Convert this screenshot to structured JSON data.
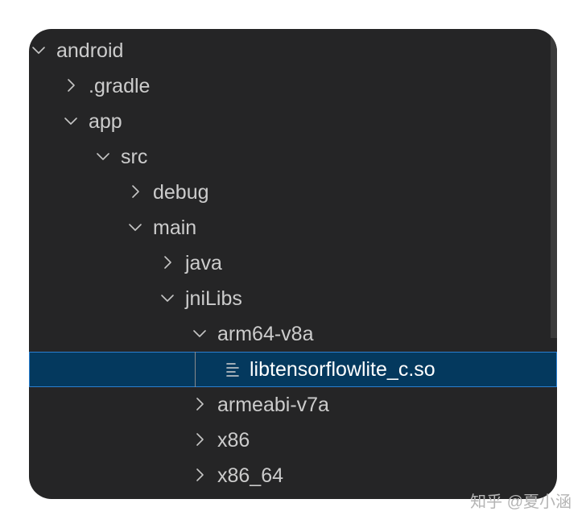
{
  "explorer": {
    "items": [
      {
        "label": "android",
        "type": "folder",
        "expanded": true,
        "depth": 0
      },
      {
        "label": ".gradle",
        "type": "folder",
        "expanded": false,
        "depth": 1
      },
      {
        "label": "app",
        "type": "folder",
        "expanded": true,
        "depth": 1
      },
      {
        "label": "src",
        "type": "folder",
        "expanded": true,
        "depth": 2
      },
      {
        "label": "debug",
        "type": "folder",
        "expanded": false,
        "depth": 3
      },
      {
        "label": "main",
        "type": "folder",
        "expanded": true,
        "depth": 3
      },
      {
        "label": "java",
        "type": "folder",
        "expanded": false,
        "depth": 4
      },
      {
        "label": "jniLibs",
        "type": "folder",
        "expanded": true,
        "depth": 4
      },
      {
        "label": "arm64-v8a",
        "type": "folder",
        "expanded": true,
        "depth": 5
      },
      {
        "label": "libtensorflowlite_c.so",
        "type": "file",
        "selected": true,
        "depth": 6
      },
      {
        "label": "armeabi-v7a",
        "type": "folder",
        "expanded": false,
        "depth": 5
      },
      {
        "label": "x86",
        "type": "folder",
        "expanded": false,
        "depth": 5
      },
      {
        "label": "x86_64",
        "type": "folder",
        "expanded": false,
        "depth": 5
      }
    ]
  },
  "icons": {
    "expanded": "chevron-down-icon",
    "collapsed": "chevron-right-icon",
    "file": "file-lines-icon"
  },
  "colors": {
    "panel_bg": "#252526",
    "selection_bg": "#04395e",
    "selection_border": "#2a7fd0",
    "text": "#cccccc"
  },
  "watermark": "知乎 @夏小涵"
}
